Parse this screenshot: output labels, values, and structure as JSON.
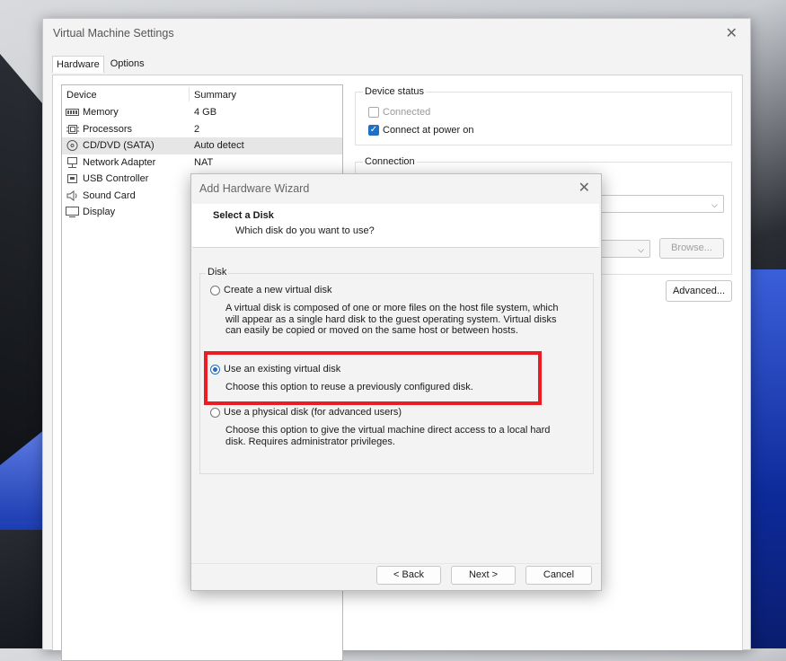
{
  "window": {
    "title": "Virtual Machine Settings",
    "tabs": [
      {
        "label": "Hardware",
        "active": true
      },
      {
        "label": "Options",
        "active": false
      }
    ]
  },
  "device_list": {
    "columns": [
      "Device",
      "Summary"
    ],
    "rows": [
      {
        "icon": "memory-icon",
        "name": "Memory",
        "summary": "4 GB",
        "selected": false
      },
      {
        "icon": "processor-icon",
        "name": "Processors",
        "summary": "2",
        "selected": false
      },
      {
        "icon": "cd-dvd-icon",
        "name": "CD/DVD (SATA)",
        "summary": "Auto detect",
        "selected": true
      },
      {
        "icon": "network-adapter-icon",
        "name": "Network Adapter",
        "summary": "NAT",
        "selected": false
      },
      {
        "icon": "usb-icon",
        "name": "USB Controller",
        "summary": "",
        "selected": false
      },
      {
        "icon": "sound-card-icon",
        "name": "Sound Card",
        "summary": "",
        "selected": false
      },
      {
        "icon": "display-icon",
        "name": "Display",
        "summary": "",
        "selected": false
      }
    ]
  },
  "device_status": {
    "label": "Device status",
    "connected": {
      "label": "Connected",
      "checked": false,
      "enabled": false
    },
    "connect_at_power_on": {
      "label": "Connect at power on",
      "checked": true,
      "enabled": true
    }
  },
  "connection": {
    "label": "Connection",
    "browse_label": "Browse...",
    "advanced_label": "Advanced..."
  },
  "wizard": {
    "title": "Add Hardware Wizard",
    "heading": "Select a Disk",
    "subheading": "Which disk do you want to use?",
    "group_label": "Disk",
    "options": [
      {
        "label": "Create a new virtual disk",
        "selected": false,
        "desc": [
          "A virtual disk is composed of one or more files on the host file system, which",
          "will appear as a single hard disk to the guest operating system. Virtual disks",
          "can easily be copied or moved on the same host or between hosts."
        ]
      },
      {
        "label": "Use an existing virtual disk",
        "selected": true,
        "desc": [
          "Choose this option to reuse a previously configured disk."
        ]
      },
      {
        "label": "Use a physical disk (for advanced users)",
        "selected": false,
        "desc": [
          "Choose this option to give the virtual machine direct access to a local hard",
          "disk. Requires administrator privileges."
        ]
      }
    ],
    "buttons": {
      "back": "< Back",
      "next": "Next >",
      "cancel": "Cancel"
    }
  },
  "colors": {
    "accent": "#1f6fc5",
    "highlight_border": "#ea1c24"
  }
}
